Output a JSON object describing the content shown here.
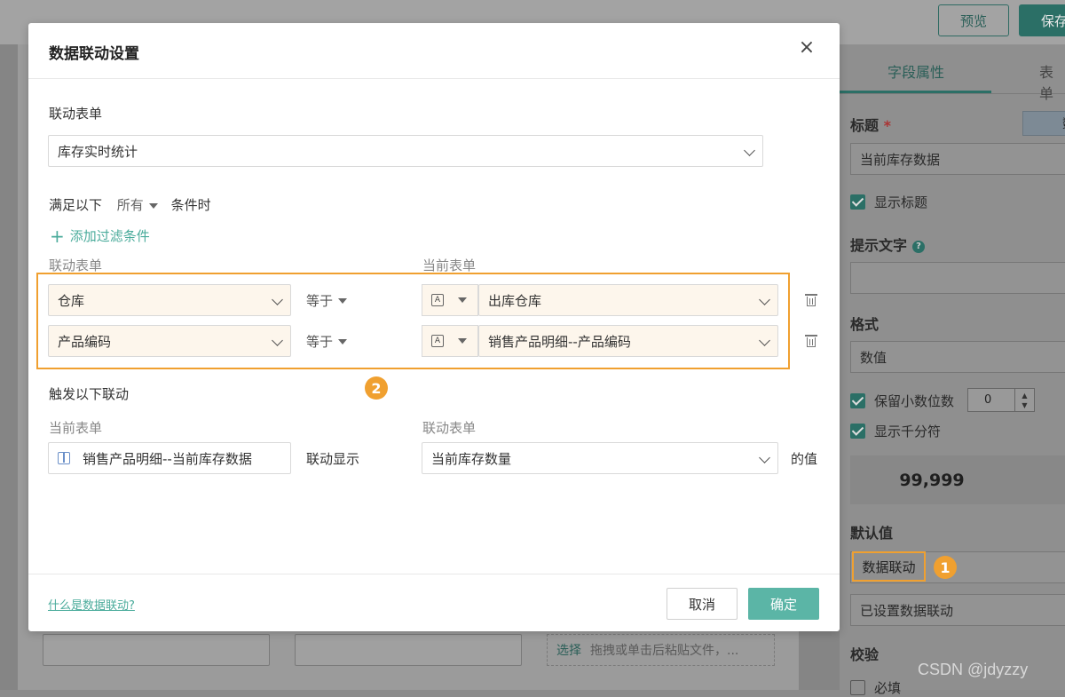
{
  "topbar": {
    "preview_label": "预览",
    "save_label": "保存"
  },
  "background": {
    "upload_select": "选择",
    "upload_hint": "拖拽或单击后粘贴文件，..."
  },
  "panel": {
    "tabs": [
      "字段属性",
      "表单"
    ],
    "title_label": "标题",
    "required_mark": "*",
    "title_tag": "数",
    "title_value": "当前库存数据",
    "show_title": "显示标题",
    "hint_label": "提示文字",
    "format_label": "格式",
    "format_value": "数值",
    "decimals_label": "保留小数位数",
    "decimals_value": "0",
    "thousands_label": "显示千分符",
    "preview_number": "99,999",
    "default_label": "默认值",
    "default_value": "数据联动",
    "linkage_status": "已设置数据联动",
    "validate_label": "校验",
    "required_label": "必填"
  },
  "badges": {
    "one": "1",
    "two": "2"
  },
  "watermark": "CSDN @jdyzzy",
  "modal": {
    "title": "数据联动设置",
    "linked_form_label": "联动表单",
    "linked_form_value": "库存实时统计",
    "condition_prefix": "满足以下",
    "condition_mode": "所有",
    "condition_suffix": "条件时",
    "add_filter": "添加过滤条件",
    "col_linked": "联动表单",
    "col_current": "当前表单",
    "rows": [
      {
        "field": "仓库",
        "op": "等于",
        "type_icon": "A",
        "value": "出库仓库"
      },
      {
        "field": "产品编码",
        "op": "等于",
        "type_icon": "A",
        "value": "销售产品明细--产品编码"
      }
    ],
    "trigger_label": "触发以下联动",
    "trigger_col_current": "当前表单",
    "trigger_col_linked": "联动表单",
    "trigger_current_field": "销售产品明细--当前库存数据",
    "trigger_mid": "联动显示",
    "trigger_linked_field": "当前库存数量",
    "trigger_suffix": "的值",
    "help_link": "什么是数据联动?",
    "cancel": "取消",
    "ok": "确定"
  }
}
